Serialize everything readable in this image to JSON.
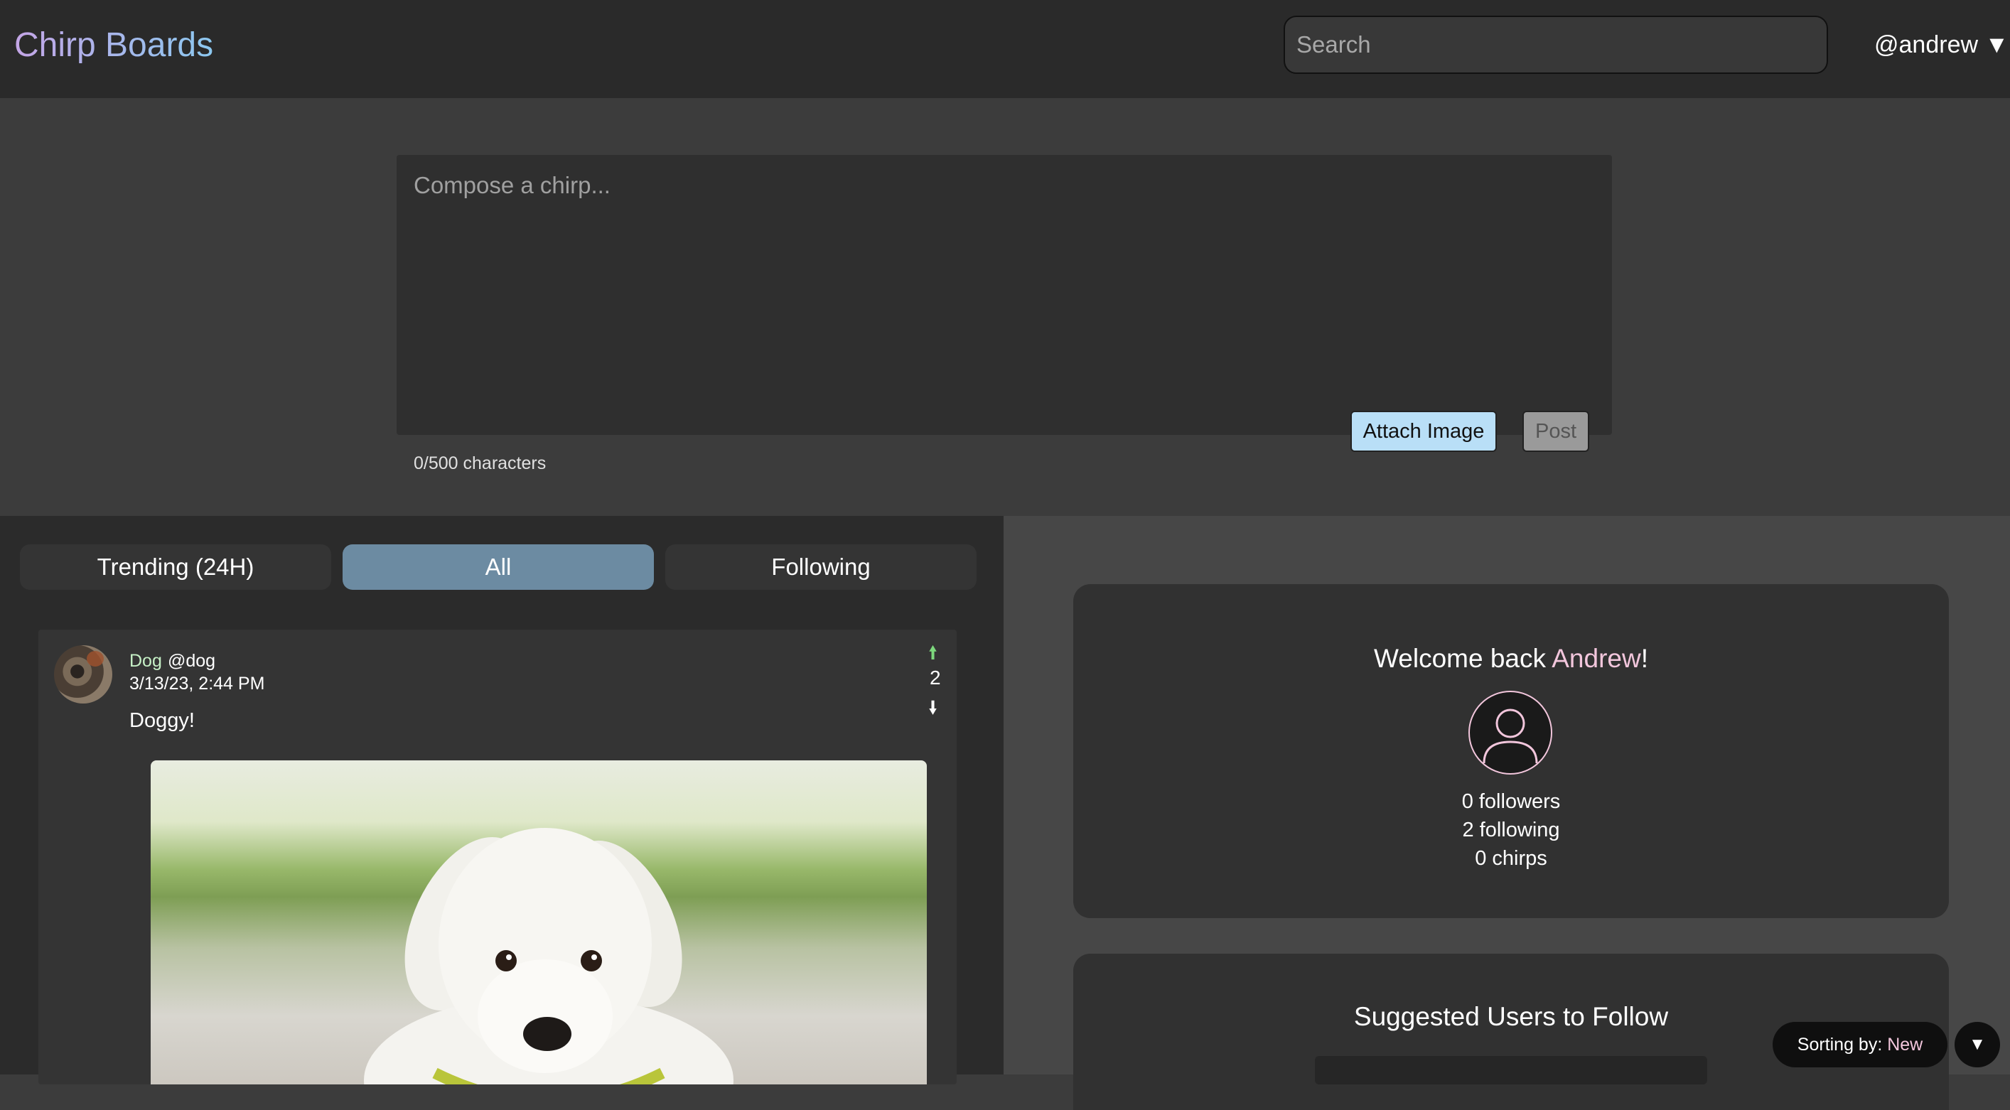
{
  "header": {
    "logo": "Chirp Boards",
    "search_placeholder": "Search",
    "user_handle": "@andrew",
    "user_menu_arrow": "▼"
  },
  "compose": {
    "placeholder": "Compose a chirp...",
    "char_count": "0/500 characters",
    "attach_label": "Attach Image",
    "post_label": "Post"
  },
  "feed": {
    "tabs": [
      {
        "label": "Trending (24H)",
        "active": false
      },
      {
        "label": "All",
        "active": true
      },
      {
        "label": "Following",
        "active": false
      }
    ],
    "chirps": [
      {
        "author_name": "Dog",
        "author_handle": "@dog",
        "timestamp": "3/13/23, 2:44 PM",
        "text": "Doggy!",
        "votes": "2",
        "upvote_icon": "arrow-up-icon",
        "downvote_icon": "arrow-down-icon",
        "image": "puppy-photo"
      }
    ]
  },
  "sidebar": {
    "welcome_prefix": "Welcome back ",
    "welcome_name": "Andrew",
    "welcome_suffix": "!",
    "followers": "0 followers",
    "following": "2 following",
    "chirps": "0 chirps",
    "suggest_title": "Suggested Users to Follow"
  },
  "sort": {
    "label": "Sorting by: ",
    "value": "New",
    "toggle": "▼"
  },
  "colors": {
    "accent_pink": "#f2c6dc",
    "tab_active": "#6c8ba2",
    "attach_button": "#b9dff7",
    "upvote": "#7dd87d"
  }
}
